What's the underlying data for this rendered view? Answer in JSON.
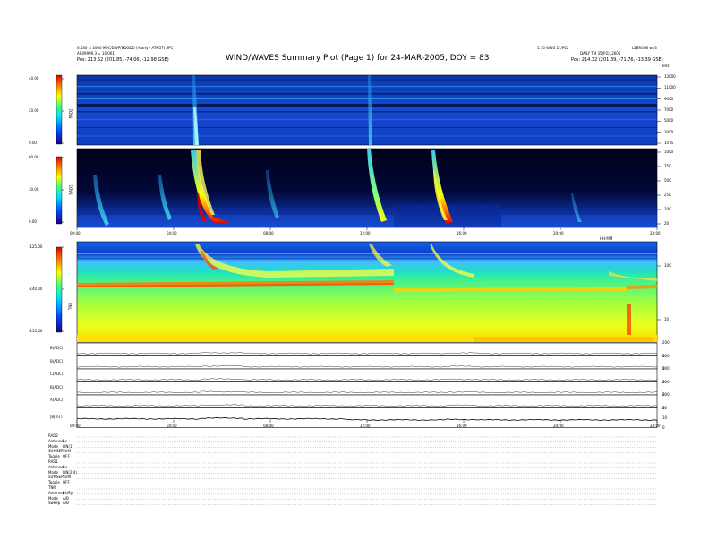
{
  "header": {
    "title": "WIND/WAVES Summary Plot (Page 1) for 24-MAR-2005, DOY = 83",
    "left_line1": "6.530 = 2000 MPC/DWP/BDGDO (Yearly - ATROT) SPC",
    "left_line2": "ARI/9999.3 = 10.061",
    "left_pos": "Pos:     213.52 (201.85, -74.06, -12.98 GSE)",
    "right_line1": "1.10 WDG 21/P02",
    "right_line2": "L2BR00B wp3",
    "right_line3": "DAILY TM 35(P2), 2005",
    "right_pos": "Pos:     214.32 (201.39, -71.76, -13.39 GSE)",
    "top_right_units": "kHz"
  },
  "panels": {
    "rad2": {
      "label": "RAD2",
      "cbar_ticks": [
        "40.00",
        "20.00",
        "0.00"
      ],
      "y_ticks": [
        "13000",
        "11000",
        "9000",
        "7000",
        "5000",
        "3000",
        "1075"
      ]
    },
    "rad1": {
      "label": "RAD1",
      "cbar_ticks": [
        "60.00",
        "30.00",
        "0.00"
      ],
      "y_ticks": [
        "1000",
        "750",
        "500",
        "250",
        "100",
        "20"
      ]
    },
    "tnr": {
      "label": "TNR",
      "cbar_ticks": [
        "-125.00",
        "-140.00",
        "-155.00"
      ],
      "y_ticks": [
        "100",
        "10"
      ]
    },
    "top_x_ticks": [
      "00:00",
      "04:00",
      "08:00",
      "12:00",
      "16:00",
      "20:00",
      "24:00"
    ],
    "tnr_x_label": "HH:MM",
    "lines": [
      {
        "label": "B(ADC)",
        "ticks": [
          "200",
          "0"
        ]
      },
      {
        "label": "B(ADC)",
        "ticks": [
          "200",
          "0"
        ]
      },
      {
        "label": "C(ADC)",
        "ticks": [
          "200",
          "0"
        ]
      },
      {
        "label": "B(ADC)",
        "ticks": [
          "200",
          "0"
        ]
      },
      {
        "label": "A(ADC)",
        "ticks": [
          "200",
          "0"
        ]
      },
      {
        "label": "|B|(nT)",
        "ticks": [
          "20",
          "10",
          "0"
        ]
      }
    ],
    "bottom_x_ticks": [
      "00:00",
      "04:00",
      "08:00",
      "12:00",
      "16:00",
      "20:00",
      "24:00"
    ]
  },
  "chart_data": [
    {
      "type": "heatmap",
      "name": "RAD2",
      "x_range_hours": [
        0,
        24
      ],
      "ylim_khz": [
        1075,
        13825
      ],
      "colorbar_range": [
        0,
        40
      ],
      "features": [
        {
          "type": "type III burst",
          "start_hour": 4.55
        },
        {
          "type": "type III burst",
          "start_hour": 12.1
        }
      ]
    },
    {
      "type": "heatmap",
      "name": "RAD1",
      "x_range_hours": [
        0,
        24
      ],
      "ylim_khz": [
        20,
        1040
      ],
      "colorbar_range": [
        0,
        60
      ],
      "bursts_start_hours": [
        1.0,
        3.3,
        4.55,
        4.9,
        7.4,
        8.6,
        12.1,
        14.4,
        20.0
      ],
      "strongest_bursts_start_hours": [
        4.55,
        12.1,
        14.4
      ]
    },
    {
      "type": "heatmap",
      "name": "TNR",
      "x_range_hours": [
        0,
        24
      ],
      "y_scale": "log",
      "colorbar_range": [
        -155,
        -125
      ],
      "features": [
        {
          "type": "plasma line",
          "level_khz": 30,
          "until_hour": 11.4,
          "after_level_khz": 24
        },
        {
          "type": "type III burst",
          "start_hour": 4.55
        },
        {
          "type": "type III burst",
          "start_hour": 10.3
        },
        {
          "type": "type III burst",
          "start_hour": 12.1
        }
      ]
    },
    {
      "type": "line",
      "series_count": 6,
      "x_range_hours": [
        0,
        24
      ],
      "description_levels": [
        {
          "label": "B(ADC)",
          "ylim": [
            0,
            200
          ],
          "level": 25
        },
        {
          "label": "B(ADC)",
          "ylim": [
            0,
            200
          ],
          "level": 20
        },
        {
          "label": "C(ADC)",
          "ylim": [
            0,
            200
          ],
          "level": 20
        },
        {
          "label": "B(ADC)",
          "ylim": [
            0,
            200
          ],
          "level": 25
        },
        {
          "label": "A(ADC)",
          "ylim": [
            0,
            200
          ],
          "level": 20
        },
        {
          "label": "|B|(nT)",
          "ylim": [
            0,
            20
          ],
          "level": 8
        }
      ]
    }
  ],
  "footer_rows": [
    {
      "k": "RAD2",
      "v": ""
    },
    {
      "k": "Antenna",
      "v": "Ex"
    },
    {
      "k": "Mode",
      "v": "LIN(1)"
    },
    {
      "k": "SUMSEP",
      "v": "SUM"
    },
    {
      "k": "Toggle",
      "v": "OFF"
    },
    {
      "k": "RAD1",
      "v": ""
    },
    {
      "k": "Antenna",
      "v": "Ex"
    },
    {
      "k": "Mode",
      "v": "LIN(2,4)"
    },
    {
      "k": "SUMSEP",
      "v": "SUM"
    },
    {
      "k": "Toggle",
      "v": "OFF"
    },
    {
      "k": "TNR",
      "v": ""
    },
    {
      "k": "Antenna",
      "v": "Ex/Ey"
    },
    {
      "k": "Mode",
      "v": "A/B"
    },
    {
      "k": "Sweep",
      "v": "A/B"
    }
  ],
  "colors": {
    "rad_bg": "#0a3fc8",
    "rad1_bg": "#00001a",
    "tnr_line": "#ff6a00"
  }
}
